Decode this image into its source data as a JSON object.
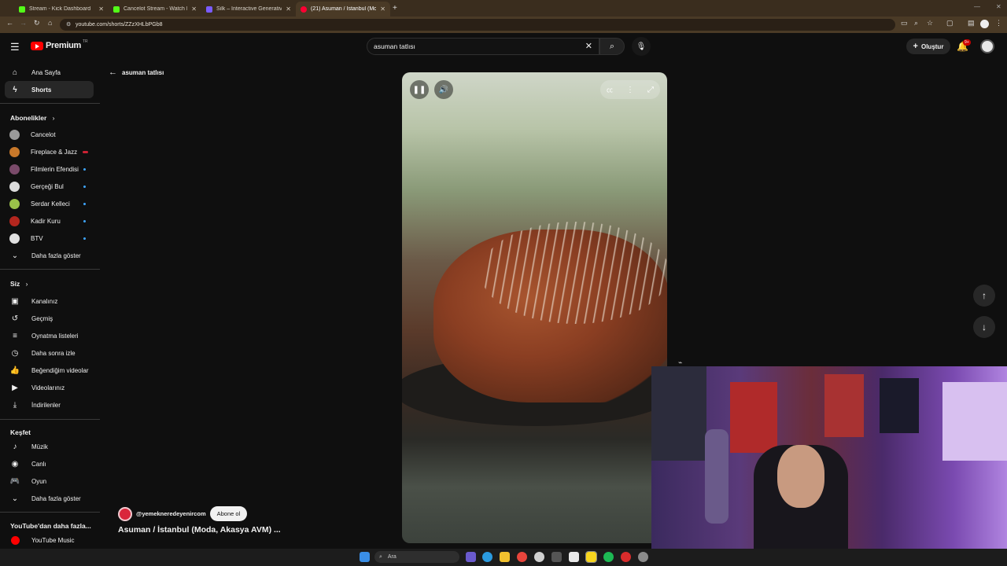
{
  "browser": {
    "tabs": [
      {
        "title": "Stream - Kick Dashboard",
        "favicon_color": "#53fc18"
      },
      {
        "title": "Cancelot Stream - Watch Live o...",
        "favicon_color": "#53fc18"
      },
      {
        "title": "Silk – Interactive Generative Art",
        "favicon_color": "#7a5cff"
      },
      {
        "title": "(21) Asuman / İstanbul (Moda,...",
        "favicon_color": "#ff0033"
      }
    ],
    "url": "youtube.com/shorts/ZZzXHLbPGb8"
  },
  "header": {
    "logo_text": "Premium",
    "country_code": "TR",
    "search_value": "asuman tatlısı",
    "create_label": "Oluştur",
    "notification_count": "9+"
  },
  "sidebar": {
    "main": [
      {
        "label": "Ana Sayfa",
        "icon": "home-icon"
      },
      {
        "label": "Shorts",
        "icon": "shorts-icon"
      }
    ],
    "subscriptions_title": "Abonelikler",
    "subscriptions": [
      {
        "label": "Cancelot",
        "color": "#9a9a9a",
        "badge": "none"
      },
      {
        "label": "Fireplace & Jazz",
        "color": "#c8782a",
        "badge": "live"
      },
      {
        "label": "Filmlerin Efendisi",
        "color": "#7a4a6a",
        "badge": "new"
      },
      {
        "label": "Gerçeği Bul",
        "color": "#dcdcdc",
        "badge": "new"
      },
      {
        "label": "Serdar Kelleci",
        "color": "#9ac14a",
        "badge": "new"
      },
      {
        "label": "Kadir Kuru",
        "color": "#b3261e",
        "badge": "new"
      },
      {
        "label": "BTV",
        "color": "#e0e0e0",
        "badge": "new"
      }
    ],
    "subscriptions_more": "Daha fazla göster",
    "you_title": "Siz",
    "you": [
      {
        "label": "Kanalınız",
        "icon": "channel-icon"
      },
      {
        "label": "Geçmiş",
        "icon": "history-icon"
      },
      {
        "label": "Oynatma listeleri",
        "icon": "playlist-icon"
      },
      {
        "label": "Daha sonra izle",
        "icon": "watch-later-icon"
      },
      {
        "label": "Beğendiğim videolar",
        "icon": "like-icon"
      },
      {
        "label": "Videolarınız",
        "icon": "videos-icon"
      },
      {
        "label": "İndirilenler",
        "icon": "download-icon"
      }
    ],
    "explore_title": "Keşfet",
    "explore": [
      {
        "label": "Müzik",
        "icon": "music-icon"
      },
      {
        "label": "Canlı",
        "icon": "live-icon"
      },
      {
        "label": "Oyun",
        "icon": "gaming-icon"
      }
    ],
    "explore_more": "Daha fazla göster",
    "more_title": "YouTube'dan daha fazla...",
    "more": [
      {
        "label": "YouTube Music",
        "icon": "youtube-music-icon"
      }
    ]
  },
  "shorts": {
    "back_label": "asuman tatlısı",
    "channel_handle": "@yemekneredeyenircom",
    "subscribe_label": "Abone ol",
    "title": "Asuman / İstanbul (Moda, Akasya AVM) ..."
  },
  "taskbar": {
    "search_placeholder": "Ara"
  }
}
